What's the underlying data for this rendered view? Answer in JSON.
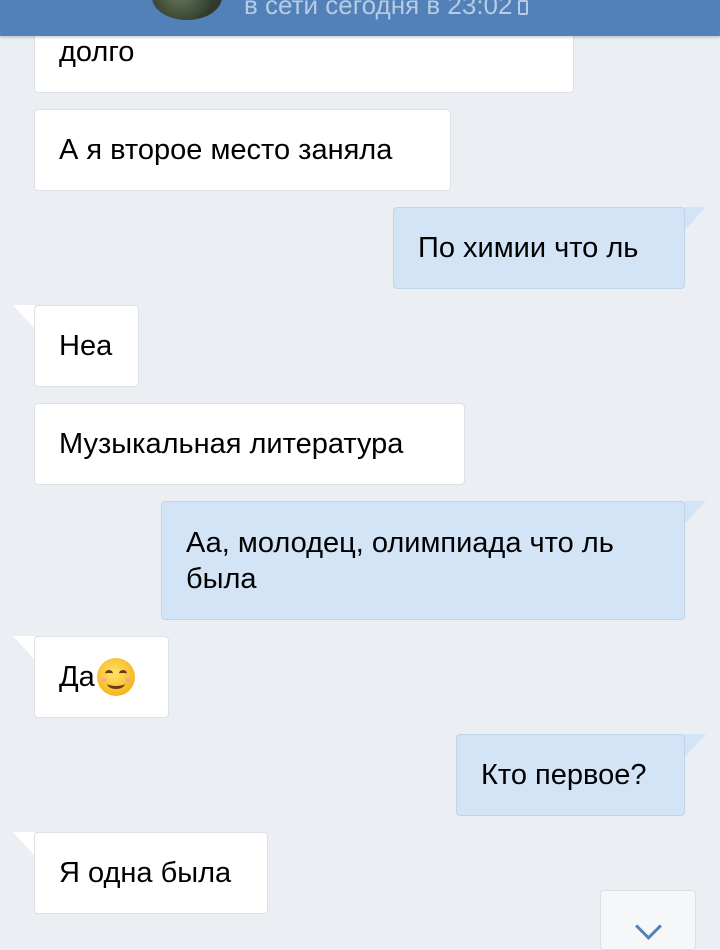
{
  "header": {
    "status_text": "в сети сегодня в 23:02",
    "online_icon": "phone-icon",
    "accent_color": "#5181b8"
  },
  "messages": [
    {
      "direction": "in",
      "text": "долго"
    },
    {
      "direction": "in",
      "text": "А я второе место заняла"
    },
    {
      "direction": "out",
      "text": "По химии что ль"
    },
    {
      "direction": "in",
      "text": "Неа"
    },
    {
      "direction": "in",
      "text": "Музыкальная литература"
    },
    {
      "direction": "out",
      "text": "Аа, молодец, олимпиада что ль была"
    },
    {
      "direction": "in",
      "text": "Да",
      "emoji": "smiling-face-icon"
    },
    {
      "direction": "out",
      "text": "Кто первое?"
    },
    {
      "direction": "in",
      "text": "Я одна была"
    }
  ],
  "scroll_button": {
    "icon": "chevron-down-icon"
  }
}
